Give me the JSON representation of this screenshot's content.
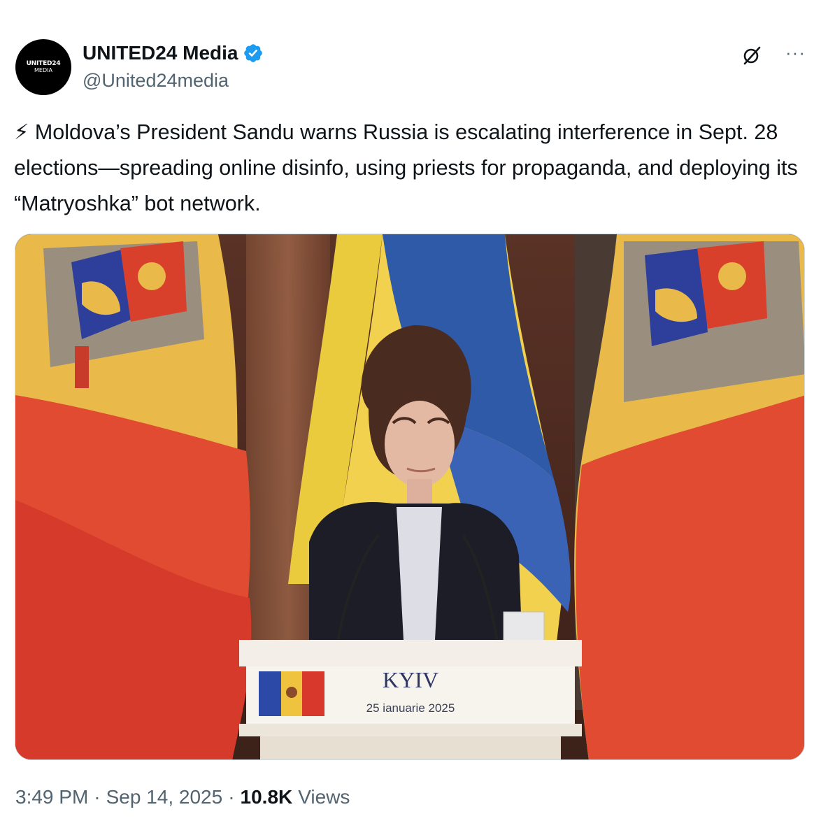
{
  "account": {
    "display_name": "UNITED24 Media",
    "handle": "@United24media",
    "avatar_line1": "UNITED24",
    "avatar_line2": "MEDIA",
    "verified_color": "#1d9bf0"
  },
  "actions": {
    "grok_icon": "grok-icon",
    "more_label": "···"
  },
  "tweet": {
    "emoji": "⚡",
    "text": " Moldova’s President Sandu warns Russia is escalating interference in Sept. 28 elections—spreading online disinfo, using priests for propaganda, and deploying its “Matryoshka” bot network."
  },
  "media": {
    "podium_city": "KYIV",
    "podium_date": "25 ianuarie 2025"
  },
  "meta": {
    "time": "3:49 PM",
    "date": "Sep 14, 2025",
    "separator": "·",
    "views_count": "10.8K",
    "views_label": "Views"
  }
}
